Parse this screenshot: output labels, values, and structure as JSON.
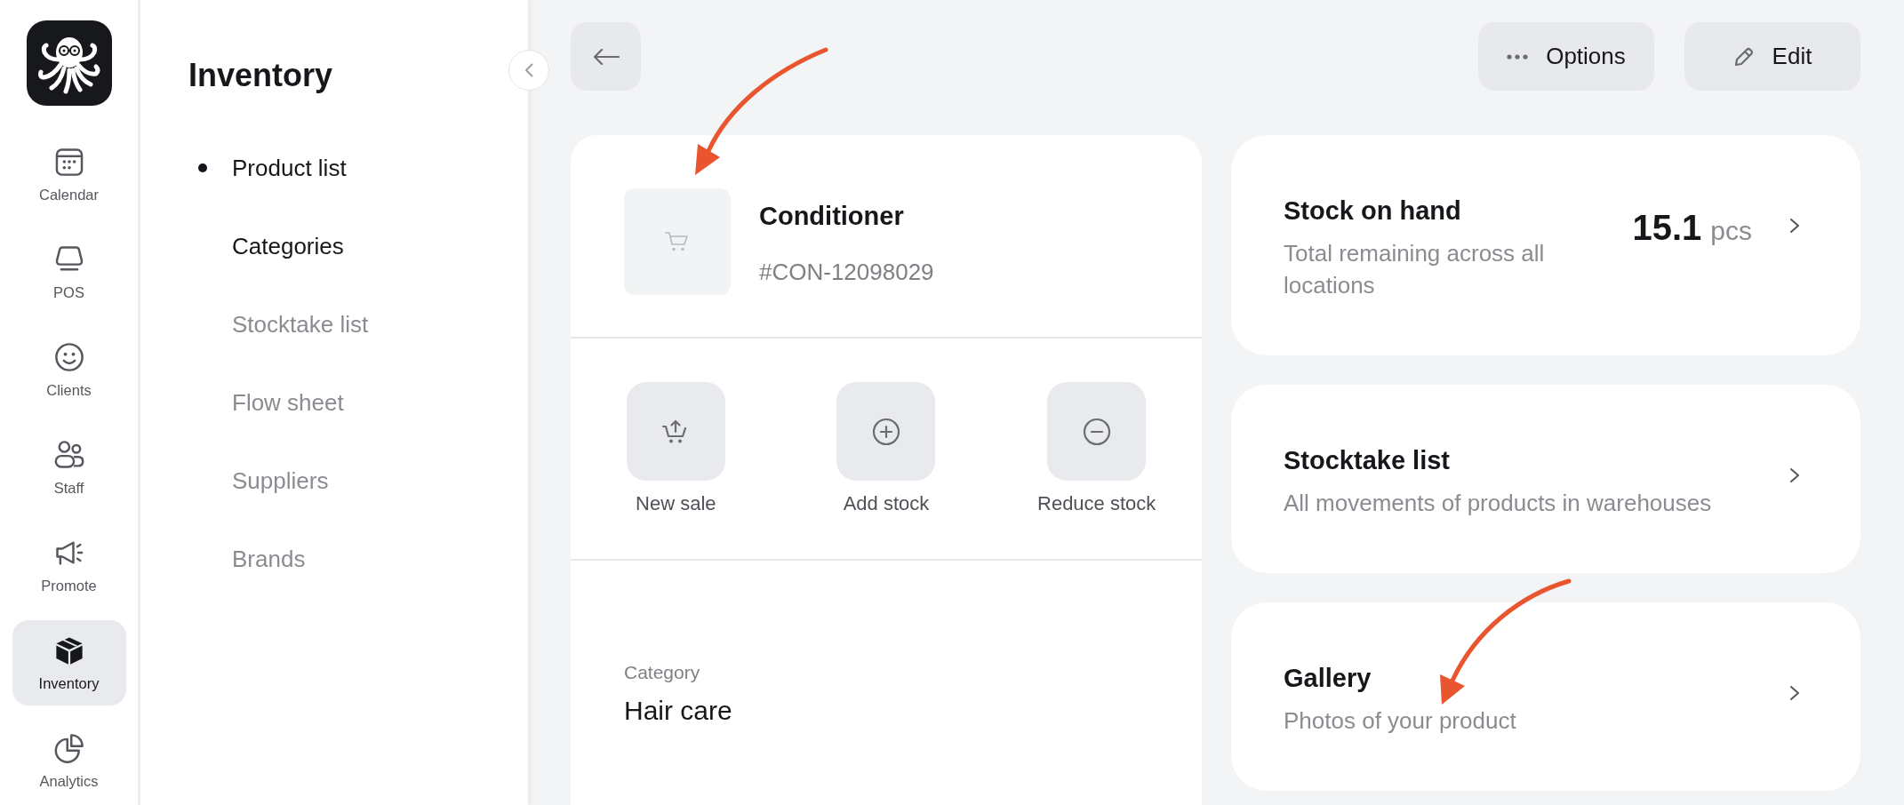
{
  "rail": {
    "items": [
      {
        "label": "Calendar",
        "selected": false
      },
      {
        "label": "POS",
        "selected": false
      },
      {
        "label": "Clients",
        "selected": false
      },
      {
        "label": "Staff",
        "selected": false
      },
      {
        "label": "Promote",
        "selected": false
      },
      {
        "label": "Inventory",
        "selected": true
      },
      {
        "label": "Analytics",
        "selected": false
      }
    ]
  },
  "sidebar": {
    "title": "Inventory",
    "items": [
      {
        "label": "Product list",
        "selected": true,
        "disabled": false
      },
      {
        "label": "Categories",
        "selected": false,
        "disabled": false
      },
      {
        "label": "Stocktake list",
        "selected": false,
        "disabled": true
      },
      {
        "label": "Flow sheet",
        "selected": false,
        "disabled": true
      },
      {
        "label": "Suppliers",
        "selected": false,
        "disabled": true
      },
      {
        "label": "Brands",
        "selected": false,
        "disabled": true
      }
    ]
  },
  "toolbar": {
    "options_button": {
      "label": "Options"
    },
    "edit_button": {
      "label": "Edit"
    }
  },
  "product": {
    "name": "Conditioner",
    "sku": "#CON-12098029",
    "actions": [
      {
        "label": "New sale"
      },
      {
        "label": "Add stock"
      },
      {
        "label": "Reduce stock"
      }
    ],
    "category": {
      "label": "Category",
      "value": "Hair care"
    }
  },
  "summary_cards": [
    {
      "title": "Stock on hand",
      "subtitle": "Total remaining across all locations",
      "value": "15.1",
      "unit": "pcs"
    },
    {
      "title": "Stocktake list",
      "subtitle": "All movements of products in warehouses"
    },
    {
      "title": "Gallery",
      "subtitle": "Photos of your product"
    }
  ]
}
